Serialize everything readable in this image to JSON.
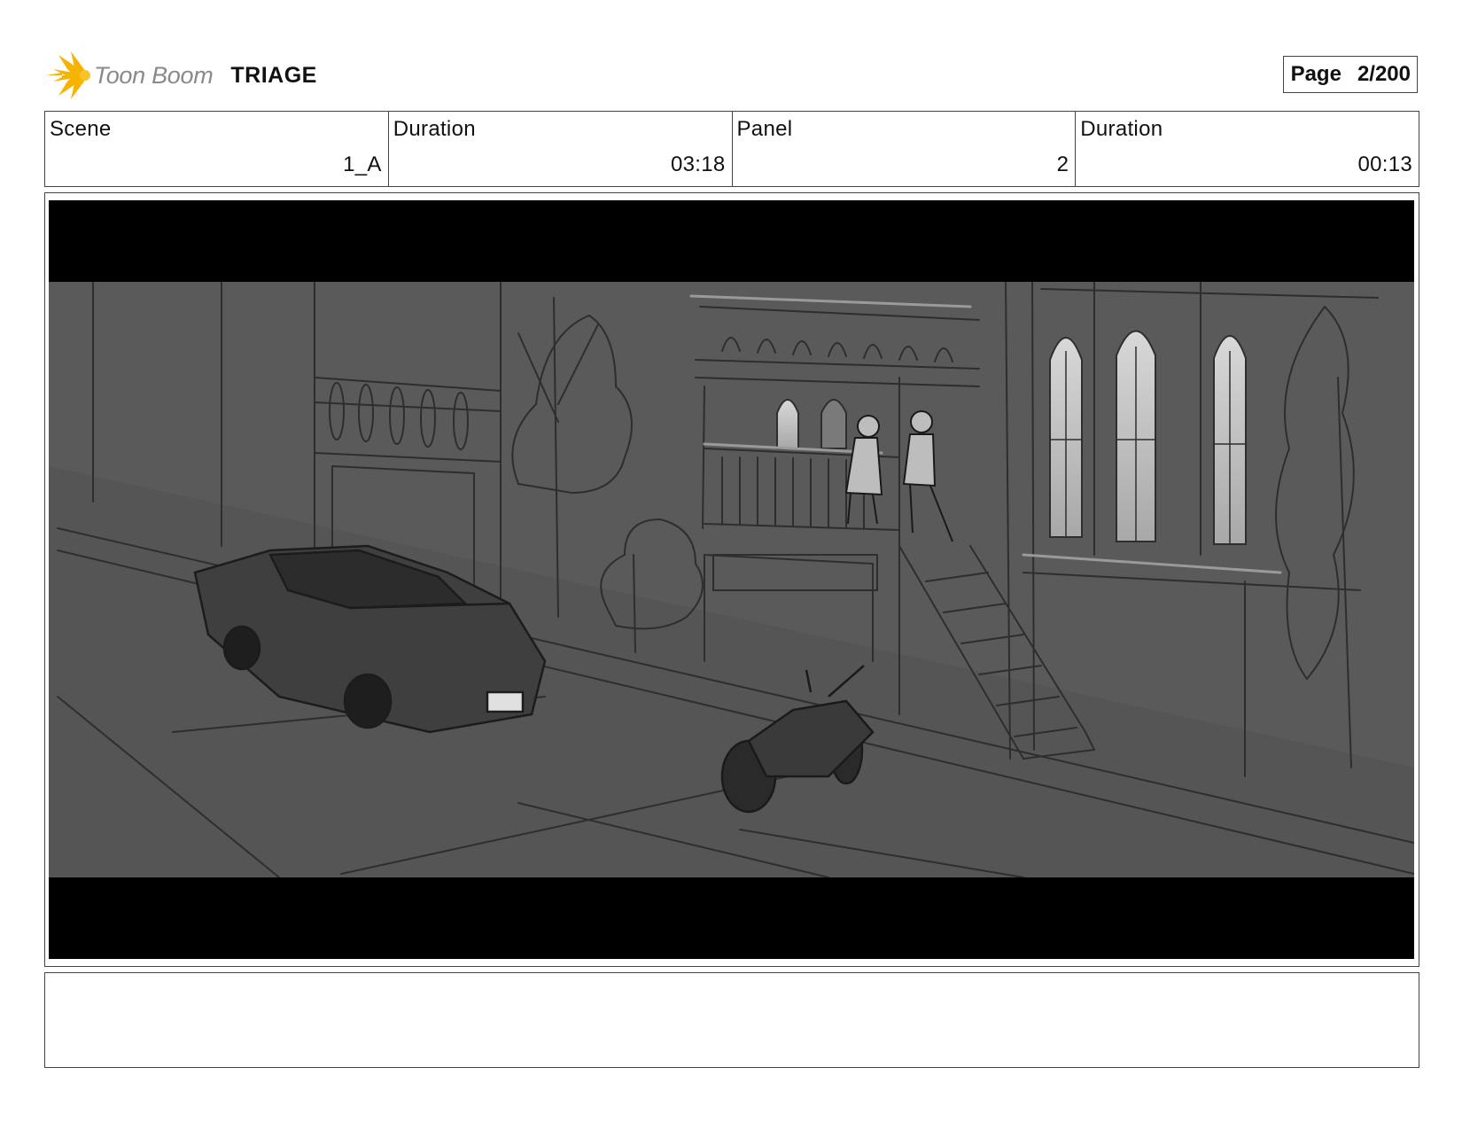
{
  "header": {
    "logo_text": "Toon Boom",
    "project_title": "TRIAGE",
    "page_label": "Page",
    "page_value": "2/200"
  },
  "info": {
    "scene_label": "Scene",
    "scene_value": "1_A",
    "scene_duration_label": "Duration",
    "scene_duration_value": "03:18",
    "panel_label": "Panel",
    "panel_value": "2",
    "panel_duration_label": "Duration",
    "panel_duration_value": "00:13"
  },
  "notes": {
    "text": ""
  },
  "colors": {
    "border": "#444444",
    "logo_yellow": "#f6b400",
    "sketch_bg": "#5a5a5a",
    "letterbox": "#000000"
  }
}
